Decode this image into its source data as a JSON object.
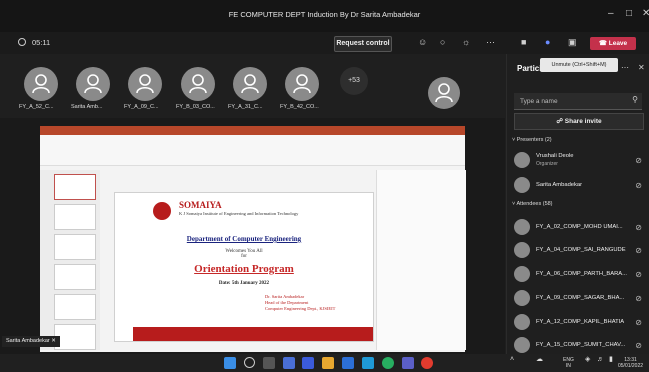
{
  "window": {
    "title": "FE COMPUTER DEPT Induction By Dr Sarita Ambadekar"
  },
  "meeting": {
    "timer": "05:11",
    "request_control": "Request control",
    "leave": "Leave",
    "tooltip": "Unmute (Ctrl+Shift+M)",
    "overflow_count": "+53"
  },
  "gallery": {
    "names": [
      "FY_A_52_C...",
      "Sarita Amb...",
      "FY_A_09_C...",
      "FY_B_03_CO...",
      "FY_A_31_C...",
      "FY_B_42_CO..."
    ]
  },
  "slide": {
    "brand": "SOMAIYA",
    "institute": "K J Somaiya Institute of Engineering and Information Technology",
    "department": "Department of Computer Engineering",
    "welcome": "Welcomes You All",
    "for": "for",
    "title": "Orientation Program",
    "date": "Date: 5th January 2022",
    "sig_name": "Dr. Sarita Ambadekar",
    "sig_role": "Head of the Department",
    "sig_dept": "Computer Engineering Dept., KJSIEIT"
  },
  "presenter_label": "Sarita Ambadekar",
  "participants": {
    "title": "Partici",
    "search_placeholder": "Type a name",
    "share_invite": "Share invite",
    "presenters_header": "Presenters (2)",
    "attendees_header": "Attendees (58)",
    "presenters": [
      {
        "name": "Vrushali Deole",
        "role": "Organizer"
      },
      {
        "name": "Sarita Ambadekar",
        "role": ""
      }
    ],
    "attendees": [
      {
        "name": "FY_A_02_COMP_MOHD UMAI..."
      },
      {
        "name": "FY_A_04_COMP_SAI_RANGUDE"
      },
      {
        "name": "FY_A_06_COMP_PARTH_BARA..."
      },
      {
        "name": "FY_A_09_COMP_SAGAR_BHA..."
      },
      {
        "name": "FY_A_12_COMP_KAPIL_BHATIA"
      },
      {
        "name": "FY_A_15_COMP_SUMIT_CHAV..."
      }
    ]
  },
  "taskbar": {
    "lang_top": "ENG",
    "lang_bottom": "IN",
    "time": "13:31",
    "date": "05/01/2022"
  }
}
